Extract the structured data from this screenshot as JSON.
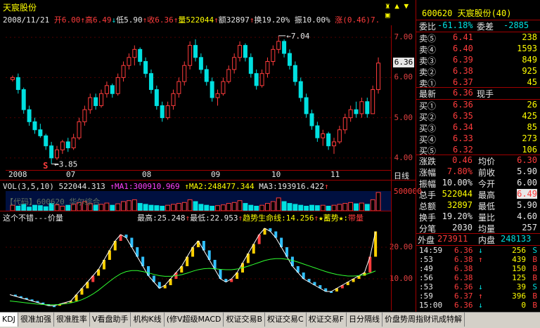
{
  "stock": {
    "name": "天宸股份",
    "code": "600620",
    "code_name": "600620 天宸股份(40)"
  },
  "header": {
    "date": "2008/11/21",
    "open": "开6.00",
    "high": "高6.49",
    "low": "低5.90",
    "close": "收6.36",
    "volume": "量522044",
    "amount": "额32897",
    "turnover": "换19.20%",
    "amplitude": "振10.00%",
    "change": "涨(0.46)7."
  },
  "kline": {
    "price_ticks": [
      "7.00",
      "6.00",
      "5.00",
      "4.00"
    ],
    "current_price": "6.36",
    "high_marker": "7.04",
    "low_marker": "3.85",
    "s_marker": "S",
    "x_labels": [
      "2008",
      "07",
      "08",
      "09",
      "10",
      "11"
    ],
    "date_line_label": "日线",
    "colors": {
      "up": "#ff3c3c",
      "down": "#00e0e0",
      "frame": "#a00000"
    },
    "candles": [
      [
        5.95,
        6.05,
        5.9,
        6.0
      ],
      [
        6.0,
        6.1,
        5.6,
        5.7
      ],
      [
        5.7,
        5.75,
        5.1,
        5.2
      ],
      [
        5.2,
        5.3,
        4.8,
        4.9
      ],
      [
        4.9,
        5.0,
        4.6,
        4.7
      ],
      [
        4.7,
        4.85,
        4.5,
        4.55
      ],
      [
        4.55,
        4.6,
        4.2,
        4.3
      ],
      [
        4.3,
        4.4,
        3.85,
        4.0
      ],
      [
        4.0,
        4.3,
        3.95,
        4.2
      ],
      [
        4.2,
        4.45,
        4.1,
        4.4
      ],
      [
        4.4,
        4.5,
        4.15,
        4.25
      ],
      [
        4.25,
        4.6,
        4.2,
        4.5
      ],
      [
        4.5,
        5.0,
        4.45,
        4.9
      ],
      [
        4.9,
        5.3,
        4.8,
        5.2
      ],
      [
        5.2,
        5.6,
        5.1,
        5.5
      ],
      [
        5.5,
        5.6,
        5.2,
        5.3
      ],
      [
        5.3,
        5.7,
        5.25,
        5.6
      ],
      [
        5.6,
        5.9,
        5.5,
        5.8
      ],
      [
        5.8,
        5.85,
        5.5,
        5.6
      ],
      [
        5.6,
        6.1,
        5.55,
        6.0
      ],
      [
        6.0,
        6.4,
        5.9,
        6.3
      ],
      [
        6.3,
        6.6,
        6.2,
        6.5
      ],
      [
        6.5,
        6.8,
        6.3,
        6.7
      ],
      [
        6.7,
        6.75,
        6.3,
        6.4
      ],
      [
        6.4,
        6.5,
        6.0,
        6.1
      ],
      [
        6.1,
        6.2,
        5.6,
        5.7
      ],
      [
        5.7,
        5.8,
        5.2,
        5.3
      ],
      [
        5.3,
        5.4,
        4.9,
        5.0
      ],
      [
        5.0,
        5.4,
        4.95,
        5.3
      ],
      [
        5.3,
        5.7,
        5.2,
        5.6
      ],
      [
        5.6,
        6.0,
        5.5,
        5.9
      ],
      [
        5.9,
        6.4,
        5.8,
        6.3
      ],
      [
        6.3,
        6.9,
        6.2,
        6.8
      ],
      [
        6.8,
        6.95,
        6.4,
        6.5
      ],
      [
        6.5,
        6.6,
        6.1,
        6.2
      ],
      [
        6.2,
        6.3,
        5.8,
        5.9
      ],
      [
        5.9,
        6.0,
        5.4,
        5.5
      ],
      [
        5.5,
        5.7,
        5.3,
        5.6
      ],
      [
        5.6,
        6.0,
        5.55,
        5.9
      ],
      [
        5.9,
        6.3,
        5.85,
        6.2
      ],
      [
        6.2,
        6.6,
        6.1,
        6.5
      ],
      [
        6.5,
        6.9,
        6.4,
        6.8
      ],
      [
        6.8,
        6.85,
        6.4,
        6.5
      ],
      [
        6.5,
        6.6,
        6.0,
        6.1
      ],
      [
        6.1,
        6.2,
        5.7,
        5.8
      ],
      [
        5.8,
        6.2,
        5.75,
        6.1
      ],
      [
        6.1,
        6.5,
        6.0,
        6.4
      ],
      [
        6.4,
        6.8,
        6.3,
        6.7
      ],
      [
        6.7,
        7.04,
        6.6,
        6.9
      ],
      [
        6.9,
        6.95,
        6.5,
        6.6
      ],
      [
        6.6,
        6.7,
        6.2,
        6.3
      ],
      [
        6.3,
        6.4,
        5.8,
        5.9
      ],
      [
        5.9,
        6.0,
        5.4,
        5.5
      ],
      [
        5.5,
        5.6,
        5.0,
        5.1
      ],
      [
        5.1,
        5.2,
        4.7,
        4.8
      ],
      [
        4.8,
        4.9,
        4.4,
        4.5
      ],
      [
        4.5,
        4.7,
        4.3,
        4.6
      ],
      [
        4.6,
        4.65,
        4.2,
        4.3
      ],
      [
        4.3,
        4.5,
        4.1,
        4.4
      ],
      [
        4.4,
        4.8,
        4.35,
        4.7
      ],
      [
        4.7,
        5.1,
        4.6,
        5.0
      ],
      [
        5.0,
        5.3,
        4.9,
        5.2
      ],
      [
        5.2,
        5.4,
        5.0,
        5.1
      ],
      [
        5.1,
        5.5,
        5.0,
        5.4
      ],
      [
        5.4,
        5.5,
        5.0,
        5.1
      ],
      [
        5.1,
        5.8,
        5.1,
        5.7
      ],
      [
        5.7,
        6.5,
        5.6,
        6.36
      ]
    ]
  },
  "volume": {
    "label": "VOL(3,5,10)",
    "value": "522044.313",
    "ma1": "↑MA1:300910.969",
    "ma2": "↑MA2:248477.344",
    "ma3": "MA3:193916.422",
    "ma3_arrow": "↑",
    "tick": "500000",
    "overlay": "【代码】600620 华尔综合",
    "bars": [
      0.3,
      0.25,
      0.35,
      0.2,
      0.3,
      0.28,
      0.22,
      0.4,
      0.32,
      0.25,
      0.3,
      0.35,
      0.45,
      0.5,
      0.4,
      0.3,
      0.35,
      0.42,
      0.3,
      0.38,
      0.5,
      0.55,
      0.6,
      0.4,
      0.35,
      0.3,
      0.28,
      0.25,
      0.3,
      0.35,
      0.4,
      0.45,
      0.6,
      0.5,
      0.35,
      0.3,
      0.25,
      0.28,
      0.32,
      0.4,
      0.45,
      0.55,
      0.4,
      0.3,
      0.25,
      0.3,
      0.4,
      0.5,
      0.7,
      0.5,
      0.4,
      0.35,
      0.3,
      0.25,
      0.3,
      0.28,
      0.3,
      0.25,
      0.3,
      0.35,
      0.4,
      0.45,
      0.38,
      0.42,
      0.35,
      0.6,
      1.0
    ]
  },
  "indicator": {
    "name": "这个不错---价量",
    "high": "最高:25.248",
    "high_arrow": "↑",
    "low": "最低:22.953",
    "low_arrow": "↑",
    "trend": "趋势生命线:14.256",
    "trend_arrow": "↑",
    "power": "★蓄势★:",
    "band": "带量",
    "ticks": [
      "20.00",
      "10.00"
    ],
    "series": [
      5,
      4.5,
      4,
      3.5,
      3,
      2.5,
      2,
      1.5,
      1.5,
      2,
      2.5,
      3,
      5,
      7,
      9,
      11,
      13,
      16,
      19,
      22,
      24,
      23,
      20,
      17,
      14,
      11,
      9,
      7,
      8,
      10,
      12,
      14,
      17,
      20,
      22,
      19,
      16,
      13,
      10,
      9,
      10,
      12,
      15,
      18,
      21,
      24,
      26,
      25,
      23,
      20,
      17,
      14,
      12,
      10,
      9,
      8,
      7,
      6,
      6,
      7,
      8,
      9,
      10,
      11,
      12,
      17,
      25
    ],
    "trend_line": [
      3,
      2.8,
      2.6,
      2.4,
      2.2,
      2,
      1.9,
      1.8,
      1.8,
      1.9,
      2.1,
      2.4,
      2.8,
      3.4,
      4.2,
      5.2,
      6.4,
      7.8,
      9.2,
      10.5,
      11.6,
      12.3,
      12.6,
      12.6,
      12.3,
      11.9,
      11.4,
      11,
      10.8,
      10.8,
      11,
      11.3,
      11.8,
      12.4,
      12.9,
      13.2,
      13.3,
      13.2,
      13,
      12.9,
      12.9,
      13.1,
      13.5,
      14,
      14.6,
      15.2,
      15.8,
      16.2,
      16.4,
      16.4,
      16.2,
      15.8,
      15.3,
      14.7,
      14.1,
      13.5,
      12.9,
      12.3,
      11.8,
      11.4,
      11.1,
      10.9,
      10.9,
      11,
      11.3,
      11.8,
      12.5
    ]
  },
  "orderbook": {
    "wei_bi_label": "委比",
    "wei_bi_value": "-61.18%",
    "wei_cha_label": "委差",
    "wei_cha_value": "-2885",
    "sells": [
      {
        "label": "卖⑤",
        "price": "6.41",
        "vol": "238"
      },
      {
        "label": "卖④",
        "price": "6.40",
        "vol": "1593"
      },
      {
        "label": "卖③",
        "price": "6.39",
        "vol": "849"
      },
      {
        "label": "卖②",
        "price": "6.38",
        "vol": "925"
      },
      {
        "label": "卖①",
        "price": "6.37",
        "vol": "45"
      }
    ],
    "latest_label": "最新",
    "latest_price": "6.36",
    "now_hand_label": "现手",
    "buys": [
      {
        "label": "买①",
        "price": "6.36",
        "vol": "26"
      },
      {
        "label": "买②",
        "price": "6.35",
        "vol": "425"
      },
      {
        "label": "买③",
        "price": "6.34",
        "vol": "85"
      },
      {
        "label": "买④",
        "price": "6.33",
        "vol": "273"
      },
      {
        "label": "买⑤",
        "price": "6.32",
        "vol": "106"
      }
    ]
  },
  "stats": [
    {
      "l1": "涨跌",
      "v1": "0.46",
      "l2": "均价",
      "v2": "6.30"
    },
    {
      "l1": "涨幅",
      "v1": "7.80%",
      "l2": "前收",
      "v2": "5.90"
    },
    {
      "l1": "振幅",
      "v1": "10.00%",
      "l2": "今开",
      "v2": "6.00"
    },
    {
      "l1": "总手",
      "v1": "522044",
      "l2": "最高",
      "v2": "6.49"
    },
    {
      "l1": "总额",
      "v1": "32897",
      "l2": "最低",
      "v2": "5.90"
    },
    {
      "l1": "换手",
      "v1": "19.20%",
      "l2": "量比",
      "v2": "4.60"
    },
    {
      "l1": "分笔",
      "v1": "2030",
      "l2": "均量",
      "v2": "257"
    }
  ],
  "pan": {
    "outer_label": "外盘",
    "outer_value": "273911",
    "inner_label": "内盘",
    "inner_value": "248133"
  },
  "ticks": [
    {
      "time": "14:59",
      "price": "6.36",
      "arrow": "↓",
      "vol": "256",
      "side": "S"
    },
    {
      "time": ":53",
      "price": "6.38",
      "arrow": "↑",
      "vol": "439",
      "side": "B"
    },
    {
      "time": ":49",
      "price": "6.38",
      "arrow": "",
      "vol": "150",
      "side": "B"
    },
    {
      "time": ":56",
      "price": "6.38",
      "arrow": "",
      "vol": "125",
      "side": "B"
    },
    {
      "time": ":53",
      "price": "6.36",
      "arrow": "↓",
      "vol": "39",
      "side": "S"
    },
    {
      "time": ":59",
      "price": "6.37",
      "arrow": "↑",
      "vol": "396",
      "side": "B"
    },
    {
      "time": "15:00",
      "price": "6.36",
      "arrow": "↓",
      "vol": "0",
      "side": "B"
    }
  ],
  "tabs": [
    "KDJ",
    "很准加强",
    "很准胜率",
    "V看盘助手",
    "机构K线",
    "(修V超级MACD",
    "权证交易B",
    "权证交易C",
    "权证交易F",
    "日分隔线",
    "价盘势周指财讯成特解"
  ]
}
